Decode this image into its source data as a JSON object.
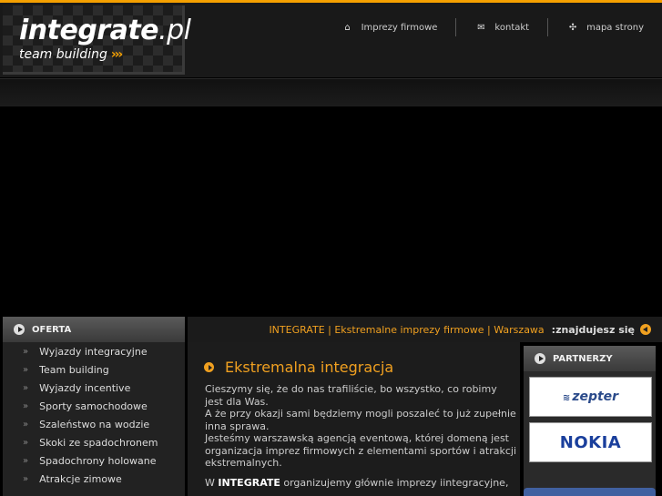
{
  "logo": {
    "main": "integrate",
    "suffix": ".pl",
    "tagline": "team building",
    "arrows": "›››"
  },
  "nav": [
    {
      "icon": "home-icon",
      "glyph": "⌂",
      "label": "Imprezy firmowe"
    },
    {
      "icon": "mail-icon",
      "glyph": "✉",
      "label": "kontakt"
    },
    {
      "icon": "sitemap-icon",
      "glyph": "✣",
      "label": "mapa strony"
    }
  ],
  "sidebar": {
    "title": "OFERTA",
    "items": [
      "Wyjazdy integracyjne",
      "Team building",
      "Wyjazdy incentive",
      "Sporty samochodowe",
      "Szaleństwo na wodzie",
      "Skoki ze spadochronem",
      "Spadochrony holowane",
      "Atrakcje zimowe"
    ],
    "marker": "»"
  },
  "breadcrumb": {
    "path": "INTEGRATE | Ekstremalne imprezy firmowe | Warszawa",
    "label": ":znajdujesz się"
  },
  "content": {
    "title": "Ekstremalna integracja",
    "para1": "Cieszymy się, że do nas trafiliście, bo wszystko, co robimy jest dla Was.",
    "para2": "A że przy okazji sami będziemy mogli poszaleć to już zupełnie inna sprawa.",
    "para3": "Jesteśmy warszawską agencją eventową, której domeną jest organizacja imprez firmowych z elementami sportów i atrakcji ekstremalnych.",
    "para4_pre": "W ",
    "para4_brand": "INTEGRATE",
    "para4_post": " organizujemy głównie imprezy iintegracyjne,"
  },
  "partners": {
    "title": "PARTNERZY",
    "items": [
      "zepter",
      "NOKIA"
    ]
  },
  "colors": {
    "accent": "#f5a000",
    "background": "#000000"
  }
}
